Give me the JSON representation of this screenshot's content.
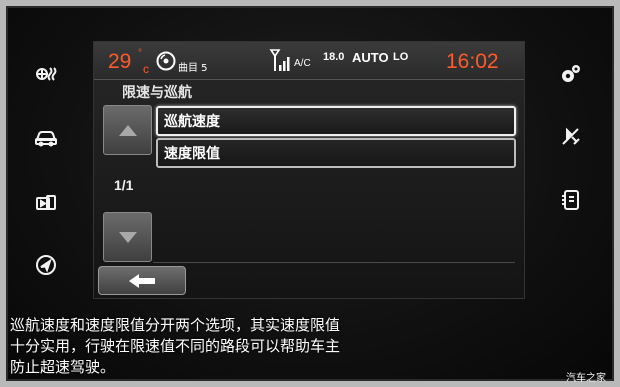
{
  "status_bar": {
    "temperature": "29",
    "temperature_unit": "°",
    "temperature_scale": "c",
    "track_label": "曲目 5",
    "ac_label": "A/C",
    "fan_value": "18.0",
    "climate_mode": "AUTO",
    "fan_level": "LO",
    "time": "16:02"
  },
  "page": {
    "title": "限速与巡航",
    "page_indicator": "1/1"
  },
  "menu": {
    "items": [
      {
        "label": "巡航速度",
        "selected": true
      },
      {
        "label": "速度限值",
        "selected": false
      }
    ]
  },
  "caption": {
    "lines": [
      "巡航速度和速度限值分开两个选项，其实速度限值",
      "十分实用，行驶在限速值不同的路段可以帮助车主",
      "防止超速驾驶。"
    ]
  },
  "watermark": "汽车之家",
  "icons": {
    "left": [
      "fan-climate-icon",
      "car-icon",
      "phone-media-icon",
      "navigation-icon"
    ],
    "right": [
      "settings-gears-icon",
      "connectivity-icon",
      "apps-icon"
    ]
  },
  "colors": {
    "accent_orange": "#ff5a2a",
    "text_white": "#ffffff",
    "screen_bg": "#1b1b1b"
  }
}
